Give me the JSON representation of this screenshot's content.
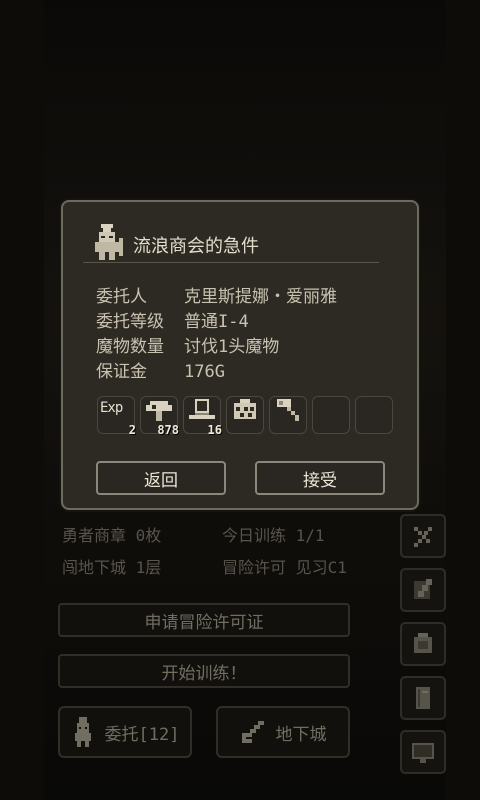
{
  "dialog": {
    "title": "流浪商会的急件",
    "client": {
      "label": "委托人",
      "value": "克里斯提娜・爱丽雅"
    },
    "rank": {
      "label": "委托等级",
      "value": "普通I-4"
    },
    "monsters": {
      "label": "魔物数量",
      "value": "讨伐1头魔物"
    },
    "deposit": {
      "label": "保证金",
      "value": "176G"
    },
    "rewards": [
      {
        "icon": "exp-icon",
        "label": "Exp",
        "qty": "2"
      },
      {
        "icon": "mushroom-icon",
        "qty": "878"
      },
      {
        "icon": "top-hat-icon",
        "qty": "16"
      },
      {
        "icon": "basket-icon",
        "qty": ""
      },
      {
        "icon": "hammer-icon",
        "qty": ""
      },
      {
        "icon": "empty-slot",
        "qty": ""
      },
      {
        "icon": "empty-slot",
        "qty": ""
      }
    ],
    "back_label": "返回",
    "accept_label": "接受"
  },
  "status": {
    "line1_left": "勇者商章 0枚",
    "line1_right": "今日训练 1/1",
    "line2_left": "闯地下城 1层",
    "line2_right": "冒险许可 见习C1"
  },
  "menu": {
    "apply_license": "申请冒险许可证",
    "start_training": "开始训练！",
    "quests": "委托[12]",
    "dungeon": "地下城"
  },
  "colors": {
    "panel": "#2d2a24",
    "border": "#6e6a5e",
    "text": "#d9d2c0"
  }
}
